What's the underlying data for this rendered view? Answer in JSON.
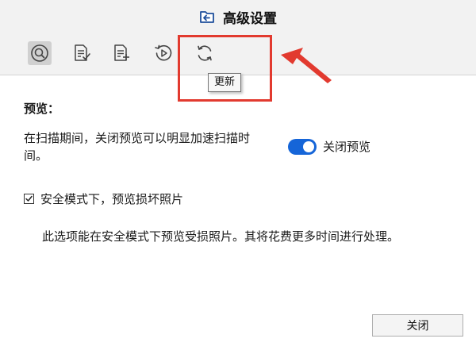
{
  "window": {
    "title": "高级设置",
    "icon": "folder-back-icon"
  },
  "toolbar": {
    "buttons": [
      {
        "icon": "search-icon",
        "active": true
      },
      {
        "icon": "document-check-icon",
        "active": false
      },
      {
        "icon": "document-add-icon",
        "active": false
      },
      {
        "icon": "history-play-icon",
        "active": false
      },
      {
        "icon": "refresh-icon",
        "active": false
      }
    ],
    "tooltip": "更新"
  },
  "annotation": {
    "color": "#e23a2f"
  },
  "preview": {
    "section_title": "预览：",
    "description": "在扫描期间，关闭预览可以明显加速扫描时间。",
    "toggle_label": "关闭预览",
    "toggle_on": true,
    "toggle_color": "#1565d8"
  },
  "safe_mode": {
    "checkbox_label": "安全模式下，预览损坏照片",
    "checked": true,
    "note": "此选项能在安全模式下预览受损照片。其将花费更多时间进行处理。"
  },
  "footer": {
    "close_label": "关闭"
  }
}
